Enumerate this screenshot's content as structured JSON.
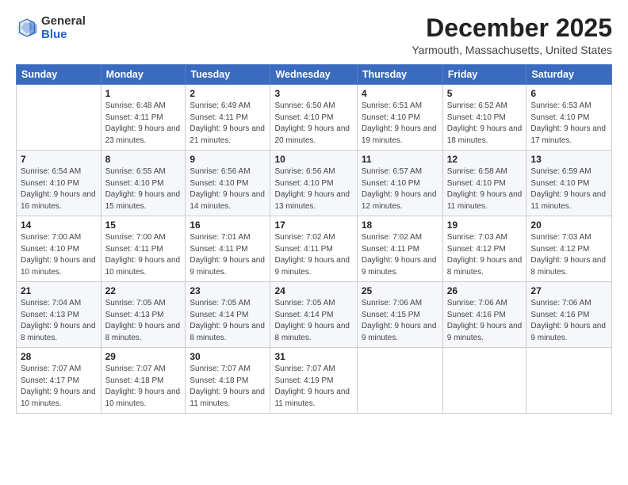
{
  "header": {
    "logo": {
      "general": "General",
      "blue": "Blue"
    },
    "month": "December 2025",
    "location": "Yarmouth, Massachusetts, United States"
  },
  "columns": [
    "Sunday",
    "Monday",
    "Tuesday",
    "Wednesday",
    "Thursday",
    "Friday",
    "Saturday"
  ],
  "weeks": [
    [
      {
        "day": "",
        "sunrise": "",
        "sunset": "",
        "daylight": ""
      },
      {
        "day": "1",
        "sunrise": "Sunrise: 6:48 AM",
        "sunset": "Sunset: 4:11 PM",
        "daylight": "Daylight: 9 hours and 23 minutes."
      },
      {
        "day": "2",
        "sunrise": "Sunrise: 6:49 AM",
        "sunset": "Sunset: 4:11 PM",
        "daylight": "Daylight: 9 hours and 21 minutes."
      },
      {
        "day": "3",
        "sunrise": "Sunrise: 6:50 AM",
        "sunset": "Sunset: 4:10 PM",
        "daylight": "Daylight: 9 hours and 20 minutes."
      },
      {
        "day": "4",
        "sunrise": "Sunrise: 6:51 AM",
        "sunset": "Sunset: 4:10 PM",
        "daylight": "Daylight: 9 hours and 19 minutes."
      },
      {
        "day": "5",
        "sunrise": "Sunrise: 6:52 AM",
        "sunset": "Sunset: 4:10 PM",
        "daylight": "Daylight: 9 hours and 18 minutes."
      },
      {
        "day": "6",
        "sunrise": "Sunrise: 6:53 AM",
        "sunset": "Sunset: 4:10 PM",
        "daylight": "Daylight: 9 hours and 17 minutes."
      }
    ],
    [
      {
        "day": "7",
        "sunrise": "Sunrise: 6:54 AM",
        "sunset": "Sunset: 4:10 PM",
        "daylight": "Daylight: 9 hours and 16 minutes."
      },
      {
        "day": "8",
        "sunrise": "Sunrise: 6:55 AM",
        "sunset": "Sunset: 4:10 PM",
        "daylight": "Daylight: 9 hours and 15 minutes."
      },
      {
        "day": "9",
        "sunrise": "Sunrise: 6:56 AM",
        "sunset": "Sunset: 4:10 PM",
        "daylight": "Daylight: 9 hours and 14 minutes."
      },
      {
        "day": "10",
        "sunrise": "Sunrise: 6:56 AM",
        "sunset": "Sunset: 4:10 PM",
        "daylight": "Daylight: 9 hours and 13 minutes."
      },
      {
        "day": "11",
        "sunrise": "Sunrise: 6:57 AM",
        "sunset": "Sunset: 4:10 PM",
        "daylight": "Daylight: 9 hours and 12 minutes."
      },
      {
        "day": "12",
        "sunrise": "Sunrise: 6:58 AM",
        "sunset": "Sunset: 4:10 PM",
        "daylight": "Daylight: 9 hours and 11 minutes."
      },
      {
        "day": "13",
        "sunrise": "Sunrise: 6:59 AM",
        "sunset": "Sunset: 4:10 PM",
        "daylight": "Daylight: 9 hours and 11 minutes."
      }
    ],
    [
      {
        "day": "14",
        "sunrise": "Sunrise: 7:00 AM",
        "sunset": "Sunset: 4:10 PM",
        "daylight": "Daylight: 9 hours and 10 minutes."
      },
      {
        "day": "15",
        "sunrise": "Sunrise: 7:00 AM",
        "sunset": "Sunset: 4:11 PM",
        "daylight": "Daylight: 9 hours and 10 minutes."
      },
      {
        "day": "16",
        "sunrise": "Sunrise: 7:01 AM",
        "sunset": "Sunset: 4:11 PM",
        "daylight": "Daylight: 9 hours and 9 minutes."
      },
      {
        "day": "17",
        "sunrise": "Sunrise: 7:02 AM",
        "sunset": "Sunset: 4:11 PM",
        "daylight": "Daylight: 9 hours and 9 minutes."
      },
      {
        "day": "18",
        "sunrise": "Sunrise: 7:02 AM",
        "sunset": "Sunset: 4:11 PM",
        "daylight": "Daylight: 9 hours and 9 minutes."
      },
      {
        "day": "19",
        "sunrise": "Sunrise: 7:03 AM",
        "sunset": "Sunset: 4:12 PM",
        "daylight": "Daylight: 9 hours and 8 minutes."
      },
      {
        "day": "20",
        "sunrise": "Sunrise: 7:03 AM",
        "sunset": "Sunset: 4:12 PM",
        "daylight": "Daylight: 9 hours and 8 minutes."
      }
    ],
    [
      {
        "day": "21",
        "sunrise": "Sunrise: 7:04 AM",
        "sunset": "Sunset: 4:13 PM",
        "daylight": "Daylight: 9 hours and 8 minutes."
      },
      {
        "day": "22",
        "sunrise": "Sunrise: 7:05 AM",
        "sunset": "Sunset: 4:13 PM",
        "daylight": "Daylight: 9 hours and 8 minutes."
      },
      {
        "day": "23",
        "sunrise": "Sunrise: 7:05 AM",
        "sunset": "Sunset: 4:14 PM",
        "daylight": "Daylight: 9 hours and 8 minutes."
      },
      {
        "day": "24",
        "sunrise": "Sunrise: 7:05 AM",
        "sunset": "Sunset: 4:14 PM",
        "daylight": "Daylight: 9 hours and 8 minutes."
      },
      {
        "day": "25",
        "sunrise": "Sunrise: 7:06 AM",
        "sunset": "Sunset: 4:15 PM",
        "daylight": "Daylight: 9 hours and 9 minutes."
      },
      {
        "day": "26",
        "sunrise": "Sunrise: 7:06 AM",
        "sunset": "Sunset: 4:16 PM",
        "daylight": "Daylight: 9 hours and 9 minutes."
      },
      {
        "day": "27",
        "sunrise": "Sunrise: 7:06 AM",
        "sunset": "Sunset: 4:16 PM",
        "daylight": "Daylight: 9 hours and 9 minutes."
      }
    ],
    [
      {
        "day": "28",
        "sunrise": "Sunrise: 7:07 AM",
        "sunset": "Sunset: 4:17 PM",
        "daylight": "Daylight: 9 hours and 10 minutes."
      },
      {
        "day": "29",
        "sunrise": "Sunrise: 7:07 AM",
        "sunset": "Sunset: 4:18 PM",
        "daylight": "Daylight: 9 hours and 10 minutes."
      },
      {
        "day": "30",
        "sunrise": "Sunrise: 7:07 AM",
        "sunset": "Sunset: 4:18 PM",
        "daylight": "Daylight: 9 hours and 11 minutes."
      },
      {
        "day": "31",
        "sunrise": "Sunrise: 7:07 AM",
        "sunset": "Sunset: 4:19 PM",
        "daylight": "Daylight: 9 hours and 11 minutes."
      },
      {
        "day": "",
        "sunrise": "",
        "sunset": "",
        "daylight": ""
      },
      {
        "day": "",
        "sunrise": "",
        "sunset": "",
        "daylight": ""
      },
      {
        "day": "",
        "sunrise": "",
        "sunset": "",
        "daylight": ""
      }
    ]
  ]
}
